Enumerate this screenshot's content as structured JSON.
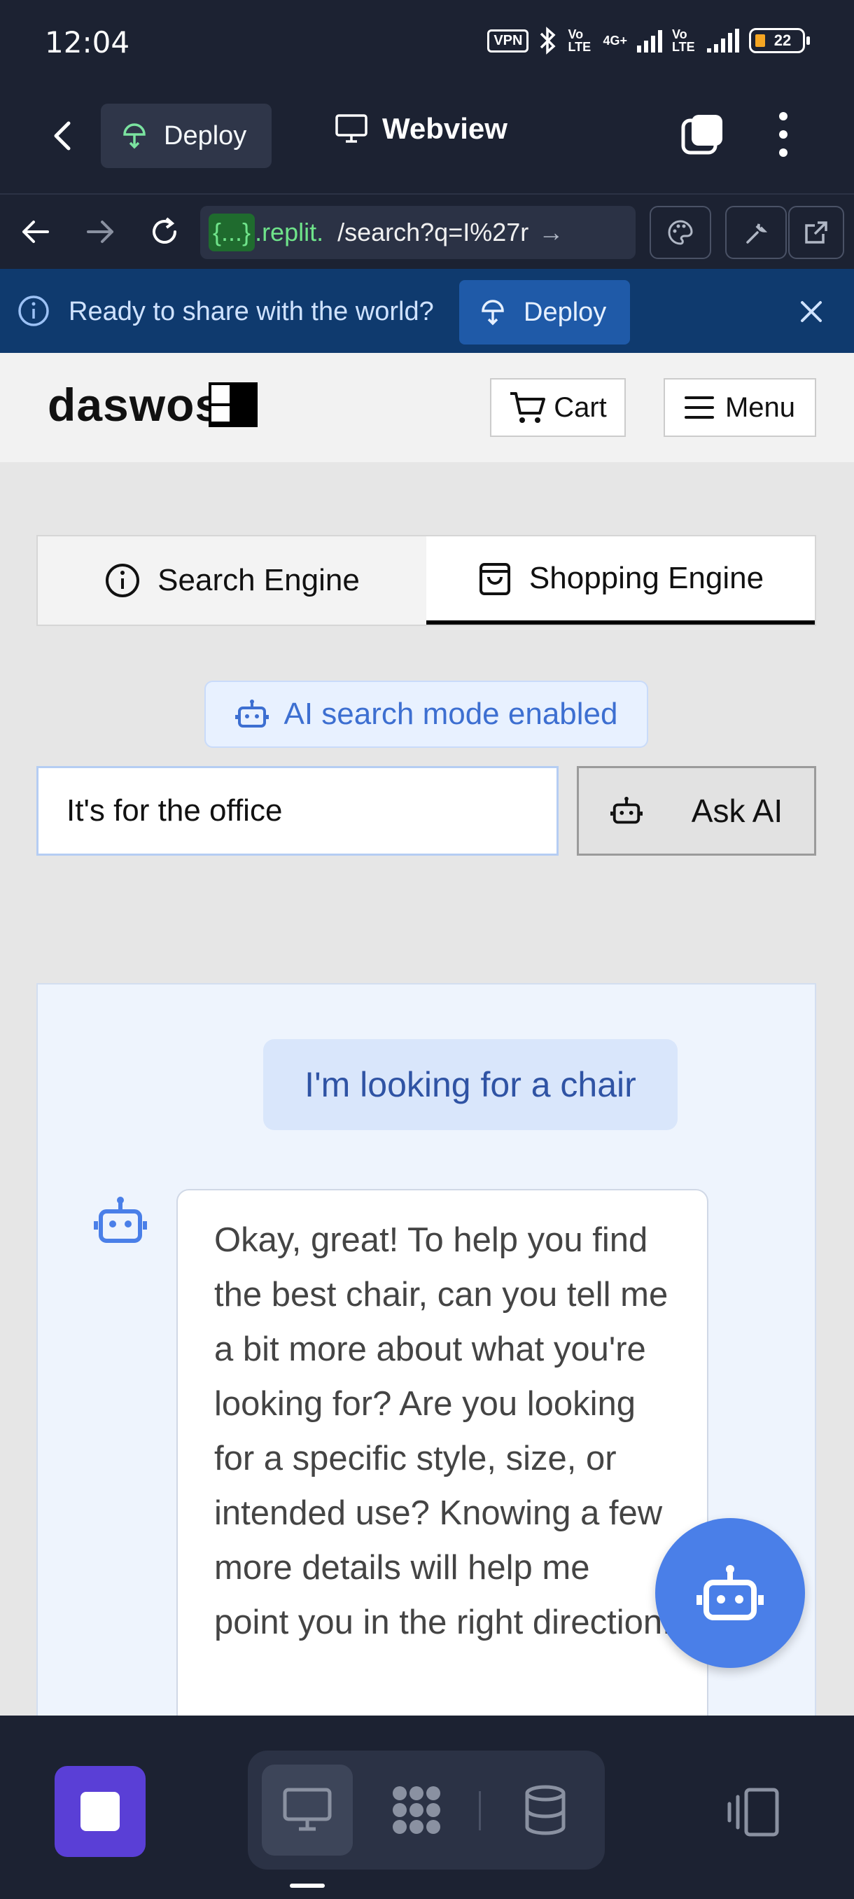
{
  "status_bar": {
    "time": "12:04",
    "vpn": "VPN",
    "network": "4G+",
    "volte": "Vo LTE",
    "battery": "22"
  },
  "app_header": {
    "deploy_label": "Deploy",
    "title": "Webview"
  },
  "url_bar": {
    "host_token": "{...}",
    "host_suffix": ".replit.",
    "path": "/search?q=I%27r"
  },
  "banner": {
    "message": "Ready to share with the world?",
    "deploy_label": "Deploy"
  },
  "site": {
    "logo_text": "daswos",
    "cart_label": "Cart",
    "menu_label": "Menu"
  },
  "tabs": [
    {
      "label": "Search Engine",
      "active": false
    },
    {
      "label": "Shopping Engine",
      "active": true
    }
  ],
  "ai_mode_badge": "AI search mode enabled",
  "search": {
    "value": "It's for the office",
    "ask_label": "Ask AI"
  },
  "chat": {
    "user_message": "I'm looking for a chair",
    "bot_message": "Okay, great! To help you find the best chair, can you tell me a bit more about what you're looking for? Are you looking for a specific style, size, or intended use? Knowing a few more details will help me point you in the right direction."
  },
  "colors": {
    "accent": "#4a7fe8",
    "banner_bg": "#0f3a6e",
    "app_bg": "#1c2232",
    "stop_button": "#5a3fd6"
  }
}
